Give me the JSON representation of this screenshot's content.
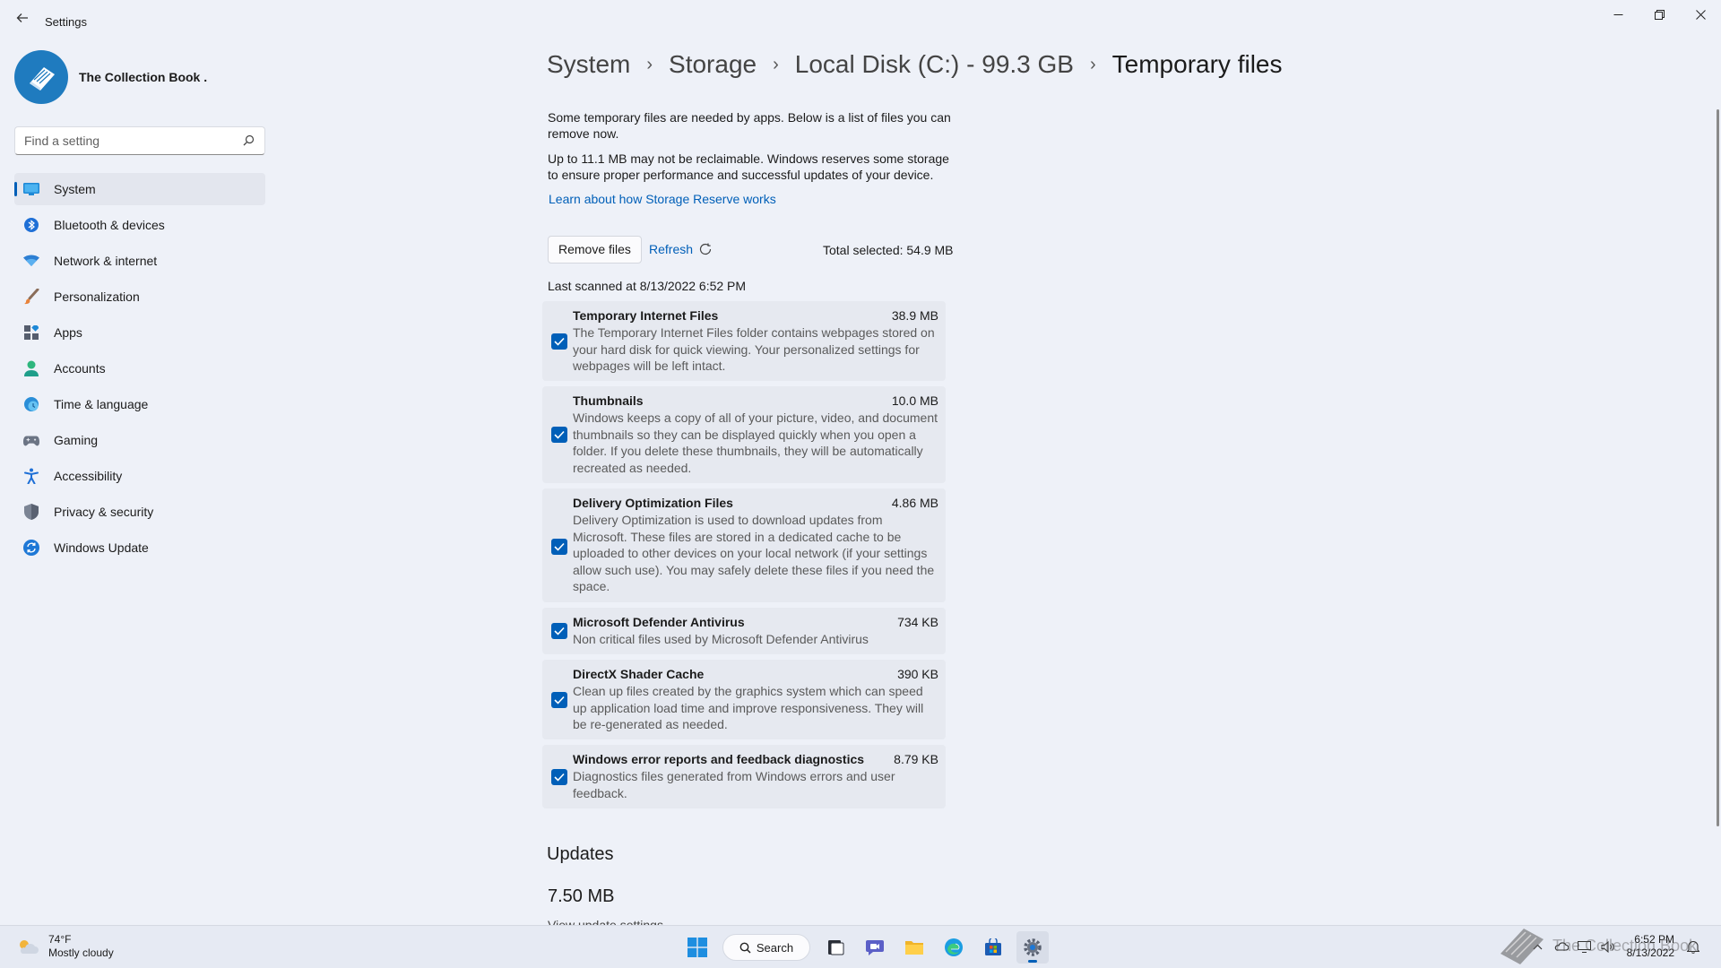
{
  "window": {
    "title": "Settings",
    "minimize": "—",
    "maximize": "❐",
    "close": "✕"
  },
  "profile": {
    "name": "The Collection Book ."
  },
  "search": {
    "placeholder": "Find a setting"
  },
  "nav": {
    "items": [
      {
        "label": "System",
        "icon": "system-icon"
      },
      {
        "label": "Bluetooth & devices",
        "icon": "bluetooth-icon"
      },
      {
        "label": "Network & internet",
        "icon": "wifi-icon"
      },
      {
        "label": "Personalization",
        "icon": "brush-icon"
      },
      {
        "label": "Apps",
        "icon": "apps-icon"
      },
      {
        "label": "Accounts",
        "icon": "accounts-icon"
      },
      {
        "label": "Time & language",
        "icon": "time-language-icon"
      },
      {
        "label": "Gaming",
        "icon": "gaming-icon"
      },
      {
        "label": "Accessibility",
        "icon": "accessibility-icon"
      },
      {
        "label": "Privacy & security",
        "icon": "shield-icon"
      },
      {
        "label": "Windows Update",
        "icon": "windows-update-icon"
      }
    ],
    "selected": "System"
  },
  "breadcrumb": {
    "items": [
      "System",
      "Storage",
      "Local Disk (C:) - 99.3 GB",
      "Temporary files"
    ]
  },
  "main": {
    "intro": "Some temporary files are needed by apps. Below is a list of files you can remove now.",
    "reserve_note": "Up to 11.1 MB may not be reclaimable. Windows reserves some storage to ensure proper performance and successful updates of your device.",
    "reserve_link": "Learn about how Storage Reserve works",
    "remove_button": "Remove files",
    "refresh_label": "Refresh",
    "total_selected": "Total selected: 54.9 MB",
    "last_scanned": "Last scanned at 8/13/2022 6:52 PM",
    "files": [
      {
        "name": "Temporary Internet Files",
        "size": "38.9 MB",
        "checked": true,
        "description": "The Temporary Internet Files folder contains webpages stored on your hard disk for quick viewing. Your personalized settings for webpages will be left intact."
      },
      {
        "name": "Thumbnails",
        "size": "10.0 MB",
        "checked": true,
        "description": "Windows keeps a copy of all of your picture, video, and document thumbnails so they can be displayed quickly when you open a folder. If you delete these thumbnails, they will be automatically recreated as needed."
      },
      {
        "name": "Delivery Optimization Files",
        "size": "4.86 MB",
        "checked": true,
        "description": "Delivery Optimization is used to download updates from Microsoft. These files are stored in a dedicated cache to be uploaded to other devices on your local network (if your settings allow such use). You may safely delete these files if you need the space."
      },
      {
        "name": "Microsoft Defender Antivirus",
        "size": "734 KB",
        "checked": true,
        "description": "Non critical files used by Microsoft Defender Antivirus"
      },
      {
        "name": "DirectX Shader Cache",
        "size": "390 KB",
        "checked": true,
        "description": "Clean up files created by the graphics system which can speed up application load time and improve responsiveness. They will be re-generated as needed."
      },
      {
        "name": "Windows error reports and feedback diagnostics",
        "size": "8.79 KB",
        "checked": true,
        "description": "Diagnostics files generated from Windows errors and user feedback."
      }
    ],
    "updates_title": "Updates",
    "updates_size": "7.50 MB",
    "updates_link": "View update settings"
  },
  "taskbar": {
    "weather_temp": "74°F",
    "weather_desc": "Mostly cloudy",
    "search_label": "Search",
    "time": "6:52 PM",
    "date": "8/13/2022",
    "watermark": "The Collection Book",
    "apps": [
      "start-icon",
      "task-view-icon",
      "chat-icon",
      "file-explorer-icon",
      "edge-icon",
      "store-icon",
      "settings-icon"
    ]
  },
  "colors": {
    "accent": "#005fb8",
    "background": "#eef1f8",
    "card": "#e6e9f0"
  }
}
